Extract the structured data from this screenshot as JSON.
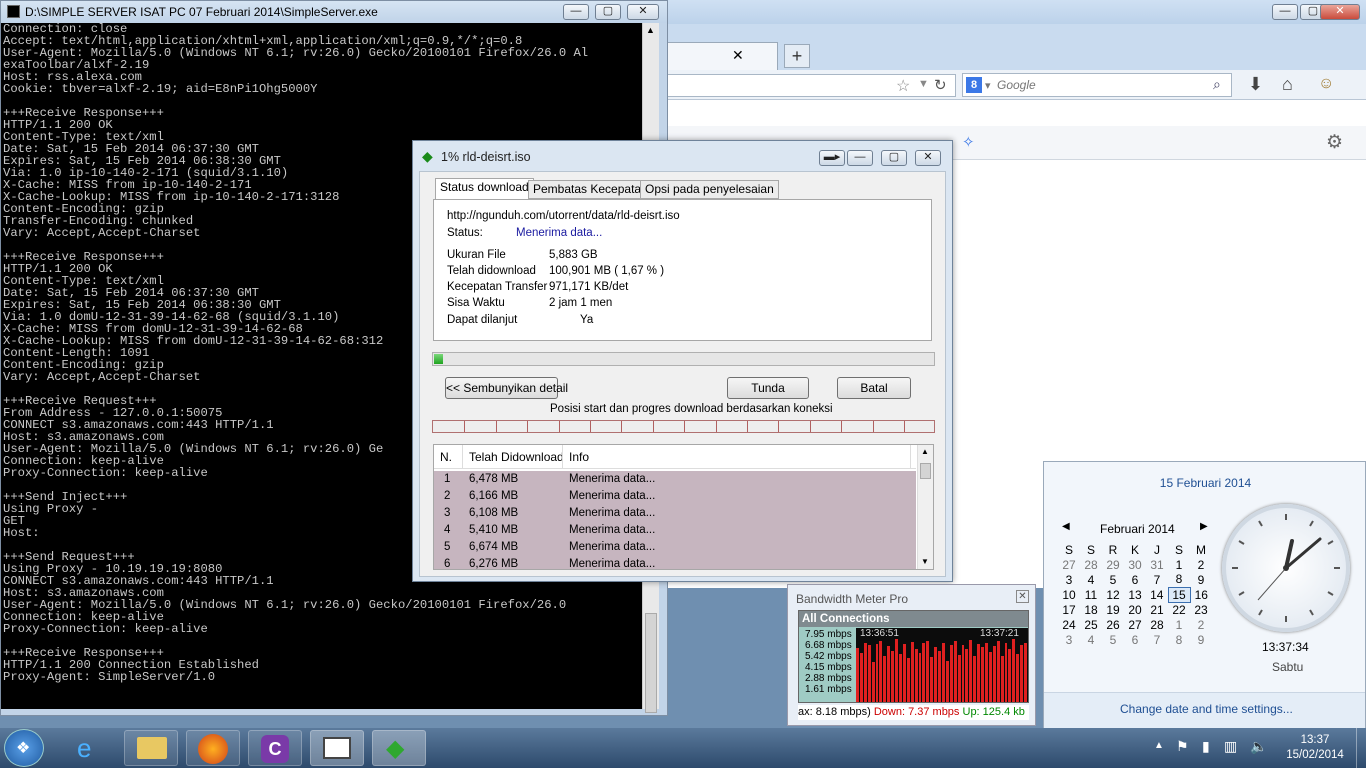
{
  "console": {
    "title": "D:\\SIMPLE SERVER ISAT PC 07 Februari 2014\\SimpleServer.exe",
    "lines": [
      "Connection: close",
      "Accept: text/html,application/xhtml+xml,application/xml;q=0.9,*/*;q=0.8",
      "User-Agent: Mozilla/5.0 (Windows NT 6.1; rv:26.0) Gecko/20100101 Firefox/26.0 Al",
      "exaToolbar/alxf-2.19",
      "Host: rss.alexa.com",
      "Cookie: tbver=alxf-2.19; aid=E8nPi1Ohg5000Y",
      "",
      "+++Receive Response+++",
      "HTTP/1.1 200 OK",
      "Content-Type: text/xml",
      "Date: Sat, 15 Feb 2014 06:37:30 GMT",
      "Expires: Sat, 15 Feb 2014 06:38:30 GMT",
      "Via: 1.0 ip-10-140-2-171 (squid/3.1.10)",
      "X-Cache: MISS from ip-10-140-2-171",
      "X-Cache-Lookup: MISS from ip-10-140-2-171:3128",
      "Content-Encoding: gzip",
      "Transfer-Encoding: chunked",
      "Vary: Accept,Accept-Charset",
      "",
      "+++Receive Response+++",
      "HTTP/1.1 200 OK",
      "Content-Type: text/xml",
      "Date: Sat, 15 Feb 2014 06:37:30 GMT",
      "Expires: Sat, 15 Feb 2014 06:38:30 GMT",
      "Via: 1.0 domU-12-31-39-14-62-68 (squid/3.1.10)",
      "X-Cache: MISS from domU-12-31-39-14-62-68",
      "X-Cache-Lookup: MISS from domU-12-31-39-14-62-68:312",
      "Content-Length: 1091",
      "Content-Encoding: gzip",
      "Vary: Accept,Accept-Charset",
      "",
      "+++Receive Request+++",
      "From Address - 127.0.0.1:50075",
      "CONNECT s3.amazonaws.com:443 HTTP/1.1",
      "Host: s3.amazonaws.com",
      "User-Agent: Mozilla/5.0 (Windows NT 6.1; rv:26.0) Ge",
      "Connection: keep-alive",
      "Proxy-Connection: keep-alive",
      "",
      "+++Send Inject+++",
      "Using Proxy - ",
      "GET ",
      "Host: ",
      "",
      "+++Send Request+++",
      "Using Proxy - 10.19.19.19:8080",
      "CONNECT s3.amazonaws.com:443 HTTP/1.1",
      "Host: s3.amazonaws.com",
      "User-Agent: Mozilla/5.0 (Windows NT 6.1; rv:26.0) Gecko/20100101 Firefox/26.0",
      "Connection: keep-alive",
      "Proxy-Connection: keep-alive",
      "",
      "+++Receive Response+++",
      "HTTP/1.1 200 Connection Established",
      "Proxy-Agent: SimpleServer/1.0"
    ]
  },
  "browser": {
    "search_placeholder": "Google"
  },
  "download": {
    "title": "1% rld-deisrt.iso",
    "tabs": [
      "Status download",
      "Pembatas Kecepatan",
      "Opsi pada penyelesaian"
    ],
    "url": "http://ngunduh.com/utorrent/data/rld-deisrt.iso",
    "status_label": "Status:",
    "status_value": "Menerima data...",
    "fields": [
      {
        "label": "Ukuran File",
        "value": "5,883  GB"
      },
      {
        "label": "Telah didownload",
        "value": "100,901  MB  ( 1,67 % )"
      },
      {
        "label": "Kecepatan Transfer",
        "value": "971,171  KB/det"
      },
      {
        "label": "Sisa Waktu",
        "value": "2 jam 1 men"
      },
      {
        "label": "Dapat dilanjut",
        "value": "Ya"
      }
    ],
    "progress_percent": 1.67,
    "btn_hide": "<< Sembunyikan detail",
    "btn_pause": "Tunda",
    "btn_cancel": "Batal",
    "conn_caption": "Posisi start dan progres download berdasarkan koneksi",
    "table_headers": [
      "N.",
      "Telah Didownload",
      "Info"
    ],
    "rows": [
      {
        "n": "1",
        "size": "6,478  MB",
        "info": "Menerima data..."
      },
      {
        "n": "2",
        "size": "6,166  MB",
        "info": "Menerima data..."
      },
      {
        "n": "3",
        "size": "6,108  MB",
        "info": "Menerima data..."
      },
      {
        "n": "4",
        "size": "5,410  MB",
        "info": "Menerima data..."
      },
      {
        "n": "5",
        "size": "6,674  MB",
        "info": "Menerima data..."
      },
      {
        "n": "6",
        "size": "6,276  MB",
        "info": "Menerima data..."
      }
    ]
  },
  "bandwidth": {
    "title": "Bandwidth Meter Pro",
    "header": "All Connections",
    "scale": [
      "7.95 mbps",
      "6.68 mbps",
      "5.42 mbps",
      "4.15 mbps",
      "2.88 mbps",
      "1.61 mbps"
    ],
    "time_start": "13:36:51",
    "time_end": "13:37:21",
    "footer_max": "ax: 8.18 mbps)",
    "footer_down": "Down: 7.37 mbps",
    "footer_up": "Up: 125.4 kb",
    "bars": [
      0.82,
      0.75,
      0.9,
      0.86,
      0.6,
      0.88,
      0.92,
      0.7,
      0.85,
      0.78,
      0.95,
      0.72,
      0.88,
      0.66,
      0.91,
      0.8,
      0.74,
      0.89,
      0.93,
      0.68,
      0.84,
      0.77,
      0.9,
      0.62,
      0.87,
      0.92,
      0.71,
      0.86,
      0.8,
      0.94,
      0.69,
      0.88,
      0.83,
      0.9,
      0.76,
      0.85,
      0.92,
      0.7,
      0.89,
      0.81,
      0.95,
      0.73,
      0.87,
      0.9
    ]
  },
  "calendar": {
    "full_date": "15 Februari 2014",
    "month": "Februari 2014",
    "days": [
      "S",
      "S",
      "R",
      "K",
      "J",
      "S",
      "M"
    ],
    "weeks": [
      [
        "27",
        "28",
        "29",
        "30",
        "31",
        "1",
        "2"
      ],
      [
        "3",
        "4",
        "5",
        "6",
        "7",
        "8",
        "9"
      ],
      [
        "10",
        "11",
        "12",
        "13",
        "14",
        "15",
        "16"
      ],
      [
        "17",
        "18",
        "19",
        "20",
        "21",
        "22",
        "23"
      ],
      [
        "24",
        "25",
        "26",
        "27",
        "28",
        "1",
        "2"
      ],
      [
        "3",
        "4",
        "5",
        "6",
        "7",
        "8",
        "9"
      ]
    ],
    "time": "13:37:34",
    "weekday": "Sabtu",
    "settings_link": "Change date and time settings..."
  },
  "taskbar": {
    "time": "13:37",
    "date": "15/02/2014"
  }
}
